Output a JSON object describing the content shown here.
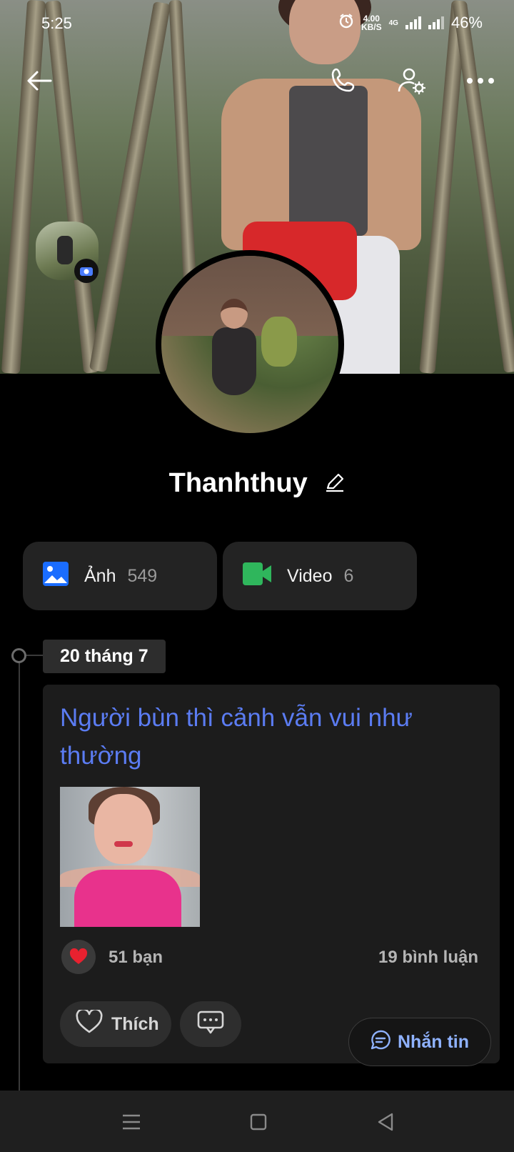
{
  "status_bar": {
    "time": "5:25",
    "net_speed_value": "4.00",
    "net_speed_unit": "KB/S",
    "network_type": "4G",
    "battery": "46%",
    "icons": [
      "alarm-icon",
      "signal-icon",
      "signal-icon"
    ]
  },
  "header": {
    "icons": [
      "back-arrow-icon",
      "phone-icon",
      "user-settings-icon",
      "more-icon"
    ]
  },
  "profile": {
    "name": "Thanhthuy",
    "edit_icon": "pencil-icon"
  },
  "media": {
    "photos_label": "Ảnh",
    "photos_count": "549",
    "videos_label": "Video",
    "videos_count": "6"
  },
  "timeline": {
    "date": "20 tháng 7",
    "post": {
      "text": "Người bùn thì cảnh vẫn vui như thường",
      "reactions": "51 bạn",
      "comments": "19 bình luận",
      "like_label": "Thích"
    }
  },
  "floating": {
    "message_label": "Nhắn tin"
  },
  "colors": {
    "background": "#000000",
    "card": "#1c1c1c",
    "post_text": "#5b7cf2",
    "photo_icon": "#1a6dff",
    "video_icon": "#2fb65c",
    "message_text": "#8fb2ff"
  }
}
